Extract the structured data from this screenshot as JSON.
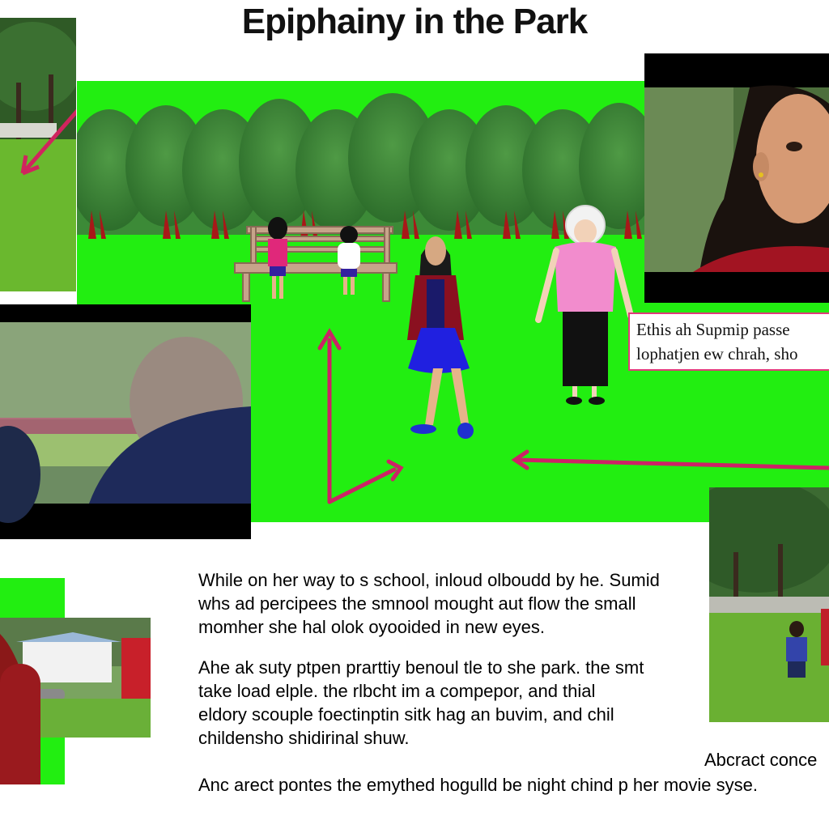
{
  "title": "Epiphainy in the Park",
  "caption_box": {
    "line1": "Ethis ah Supmip passe",
    "line2": "lophatjen ew chrah, sho"
  },
  "paragraph1": [
    "While on her way to s school, inloud olboudd by he. Sumid",
    "whs ad percipees the smnool mought aut flow the small",
    "momher she hal olok oyooided in new eyes."
  ],
  "paragraph2": [
    "Ahe ak suty ptpen prarttiy benoul tle to she park. the smt",
    "take load elple. the rlbcht im a compepor, and thial",
    "eldory scouple foectinptin sitk hag an buvim, and chil",
    "childensho shidirinal shuw."
  ],
  "abstract_label": "Abcract conce",
  "bottom_line": "Anc arect pontes the emythed hogulld be night chind p her movie syse.",
  "colors": {
    "screen_green": "#22ee11",
    "arrow": "#cc2266",
    "caption_border": "#e03a7a"
  }
}
